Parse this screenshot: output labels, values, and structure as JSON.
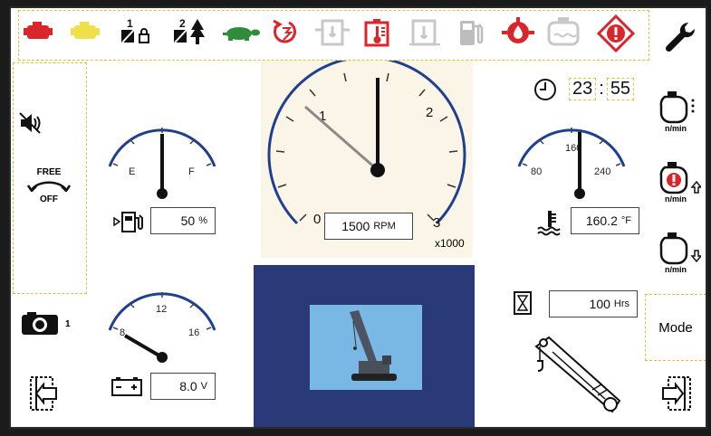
{
  "top_icons": [
    {
      "name": "engine-oil-red-icon"
    },
    {
      "name": "engine-oil-yellow-icon"
    },
    {
      "name": "winch-1-lock-icon",
      "label": "1"
    },
    {
      "name": "winch-2-tree-icon",
      "label": "2"
    },
    {
      "name": "turtle-slow-mode-icon"
    },
    {
      "name": "engine-restart-icon"
    },
    {
      "name": "hydraulic-filter-grey-icon"
    },
    {
      "name": "hydraulic-temp-red-icon"
    },
    {
      "name": "hydraulic-level-grey-icon"
    },
    {
      "name": "fuel-pump-grey-icon"
    },
    {
      "name": "oil-pressure-red-icon"
    },
    {
      "name": "coolant-level-grey-icon"
    },
    {
      "name": "warning-diamond-icon"
    }
  ],
  "left": {
    "free_label": "FREE",
    "off_label": "OFF",
    "camera_number": "1"
  },
  "fuel": {
    "e_label": "E",
    "f_label": "F",
    "value": "50",
    "unit": "%",
    "level": 0.5
  },
  "battery": {
    "ticks": [
      "8",
      "12",
      "16"
    ],
    "value": "8.0",
    "unit": "V",
    "min": 8,
    "max": 16,
    "level": 8.0
  },
  "rpm": {
    "ticks": [
      "0",
      "1",
      "2",
      "3"
    ],
    "value": "1500",
    "unit": "RPM",
    "multiplier": "x1000",
    "needle": 1.5,
    "max": 3
  },
  "clock": {
    "hours": "23",
    "sep": ":",
    "minutes": "55"
  },
  "temp": {
    "ticks": [
      "80",
      "160",
      "240"
    ],
    "value": "160.2",
    "unit": "°F",
    "level": 160,
    "min": 40,
    "max": 280
  },
  "hours": {
    "value": "100",
    "unit": "Hrs"
  },
  "right": {
    "rpm1_label": "n/min",
    "rpm_up_label": "n/min",
    "rpm_down_label": "n/min",
    "mode_label": "Mode"
  },
  "colors": {
    "accent": "#1f3f8f",
    "camera_bg": "#2a3a78",
    "warn_red": "#d8262b",
    "frame_yellow": "#e2c23c"
  }
}
